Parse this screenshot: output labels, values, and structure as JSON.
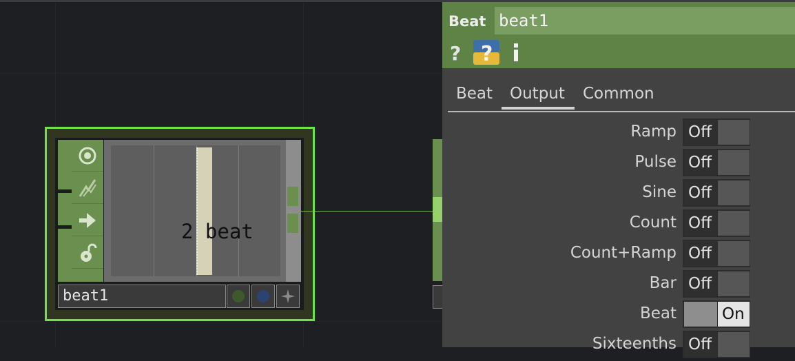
{
  "network": {
    "node": {
      "name": "beat1",
      "viewer_text": "2 beat",
      "icons": [
        "viewer-toggle-icon",
        "cook-icon",
        "export-icon",
        "lock-icon"
      ],
      "flags": [
        "bypass-flag-icon",
        "display-flag-icon",
        "pin-icon"
      ]
    }
  },
  "panel": {
    "op_type": "Beat",
    "op_name": "beat1",
    "header_icons": [
      "help-icon",
      "python-help-icon",
      "info-icon"
    ],
    "tabs": [
      {
        "label": "Beat",
        "active": false
      },
      {
        "label": "Output",
        "active": true
      },
      {
        "label": "Common",
        "active": false
      }
    ],
    "params": [
      {
        "label": "Ramp",
        "value": "Off",
        "on": false
      },
      {
        "label": "Pulse",
        "value": "Off",
        "on": false
      },
      {
        "label": "Sine",
        "value": "Off",
        "on": false
      },
      {
        "label": "Count",
        "value": "Off",
        "on": false
      },
      {
        "label": "Count+Ramp",
        "value": "Off",
        "on": false
      },
      {
        "label": "Bar",
        "value": "Off",
        "on": false
      },
      {
        "label": "Beat",
        "value": "On",
        "on": true
      },
      {
        "label": "Sixteenths",
        "value": "Off",
        "on": false
      }
    ]
  },
  "colors": {
    "op_green": "#6b8f4f",
    "selected_outline": "#6fe24a",
    "panel_header": "#5f8346"
  }
}
